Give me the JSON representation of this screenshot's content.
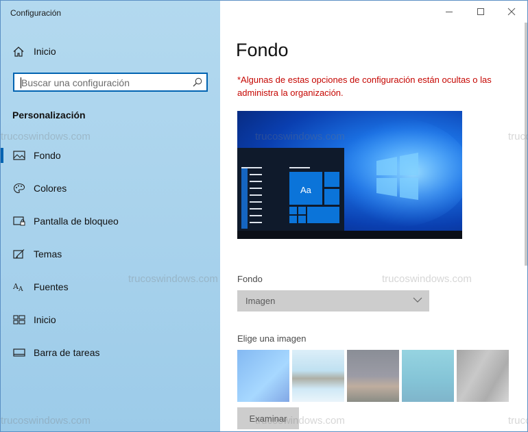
{
  "window": {
    "title": "Configuración"
  },
  "sidebar": {
    "home_label": "Inicio",
    "search_placeholder": "Buscar una configuración",
    "section_title": "Personalización",
    "items": [
      {
        "label": "Fondo",
        "icon": "picture-icon",
        "active": true
      },
      {
        "label": "Colores",
        "icon": "palette-icon",
        "active": false
      },
      {
        "label": "Pantalla de bloqueo",
        "icon": "lock-screen-icon",
        "active": false
      },
      {
        "label": "Temas",
        "icon": "themes-icon",
        "active": false
      },
      {
        "label": "Fuentes",
        "icon": "fonts-icon",
        "active": false
      },
      {
        "label": "Inicio",
        "icon": "start-icon",
        "active": false
      },
      {
        "label": "Barra de tareas",
        "icon": "taskbar-icon",
        "active": false
      }
    ]
  },
  "main": {
    "title": "Fondo",
    "warning": "*Algunas de estas opciones de configuración están ocultas o las administra la organización.",
    "preview": {
      "tile_label": "Aa"
    },
    "background_label": "Fondo",
    "background_value": "Imagen",
    "choose_label": "Elige una imagen",
    "browse_label": "Examinar"
  },
  "watermark": "trucoswindows.com",
  "colors": {
    "accent": "#0063b1",
    "warning": "#c50500",
    "sidebar": "#a8d2ec"
  }
}
